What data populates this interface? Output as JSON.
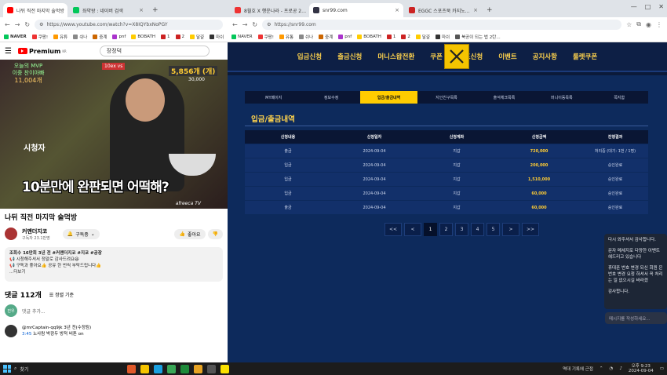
{
  "left_window": {
    "tabs": [
      {
        "label": "나뒤 직전 마지막 술먹방",
        "color": "#ff0000",
        "active": true
      },
      {
        "label": "좌약왕 : 네이버 검색",
        "color": "#03c75a",
        "active": false
      }
    ],
    "url": "https://www.youtube.com/watch?v=X8IQYbxNoPGY",
    "bookmarks": [
      "NAVER",
      "쿠팡!",
      "유튜",
      "쉬나",
      "중계",
      "pnf",
      "BOBATH",
      "1",
      "2",
      "달걀",
      "마쉬"
    ],
    "youtube": {
      "logo": "Premium",
      "logo_sup": "KR",
      "search_value": "장정덕",
      "video": {
        "mvp_label": "오늘의 MVP",
        "mvp_sub": "이중 찬이아빠",
        "mvp_count": "11,004개",
        "badge1": "10ex vs",
        "badge2": "5,856개 (개)",
        "badge3": "30,000",
        "side_rank": "시청자",
        "caption": "10분만에 완판되면 어떡해?",
        "watermark": "afreeca TV"
      },
      "title": "나뒤 직전 마지막 술먹방",
      "channel_name": "커맨더지코",
      "subscribers": "구독자 23.1만명",
      "subscribe_label": "구독중",
      "like_label": "좋아요",
      "desc_lines": [
        "조회수 16만회 3년 전 #커맨더지코 #지코 #공장",
        "📢 시청해주셔서 정말로 감사드려요😆",
        "📢 구독과 좋아요👍 공유 한 번씩 부탁드립니다👍",
        "...더보기"
      ],
      "comment_count": "댓글 112개",
      "sort_label": "정렬 기준",
      "my_avatar": "진우",
      "comment_placeholder": "댓글 추가...",
      "first_comment_user": "@mrCaptain-qq9jk 3년 전(수정됨)",
      "first_comment_time": "3:45",
      "first_comment_text": "노사람 박광두 방적 비톤 on"
    }
  },
  "right_window": {
    "tabs": [
      {
        "label": "8월호 X 행운나라 - 프로공 2…",
        "color": "#e33",
        "active": false
      },
      {
        "label": "snr99.com",
        "color": "#334",
        "active": true
      },
      {
        "label": "EGGC 스포츠북 카지노…",
        "color": "#c22",
        "active": false
      }
    ],
    "url": "https://snr99.com",
    "bookmarks": [
      "NAVER",
      "쿠팡!",
      "유통",
      "쉬나",
      "중계",
      "pnf",
      "BOBATH",
      "1",
      "2",
      "달걀",
      "마쉬",
      "북공이 되는 법 2탄…"
    ],
    "site_nav": [
      "입금신청",
      "출금신청",
      "머니스왑전환",
      "쿠폰",
      "콤프신청",
      "이벤트",
      "공지사항",
      "룰렛쿠폰"
    ],
    "sub_nav": [
      "MY페이지",
      "정보수정",
      "입금/출금내역",
      "지인친구목록",
      "출석체크목록",
      "머니이동목록",
      "쪽지함"
    ],
    "sub_nav_active": 2,
    "page_title": "입금/출금내역",
    "table": {
      "headers": [
        "신청내용",
        "신청일자",
        "신청계좌",
        "신청금액",
        "진행결과"
      ],
      "rows": [
        [
          "출금",
          "2024-09-04",
          "지갑",
          "720,000",
          "처리중 (대기: 1번 / 1명)"
        ],
        [
          "입금",
          "2024-09-04",
          "지갑",
          "200,000",
          "승인완료"
        ],
        [
          "입금",
          "2024-09-04",
          "지갑",
          "1,510,000",
          "승인완료"
        ],
        [
          "입금",
          "2024-09-04",
          "지갑",
          "60,000",
          "승인완료"
        ],
        [
          "출금",
          "2024-09-04",
          "지갑",
          "60,000",
          "승인완료"
        ]
      ]
    },
    "pager": [
      "<<",
      "<",
      "1",
      "2",
      "3",
      "4",
      "5",
      ">",
      ">>"
    ],
    "pager_active": "1",
    "chat_lines": [
      "다시 와주셔서 감사합니다.",
      "",
      "문자 메세지로 다양한 이벤트 헤드리고 있습니다",
      "",
      "휴대폰 번호 변경 되신 회원 은 번호 변경 요청 하셔서 꼭 처리는 일 없으시길 바라겠",
      "",
      "감사합니다."
    ],
    "chat_placeholder": "메시지를 작성하세요..."
  },
  "taskbar": {
    "search_label": "찾기",
    "weather": "역대 기록에 근접",
    "time": "오후 9:23",
    "date": "2024-09-04"
  }
}
